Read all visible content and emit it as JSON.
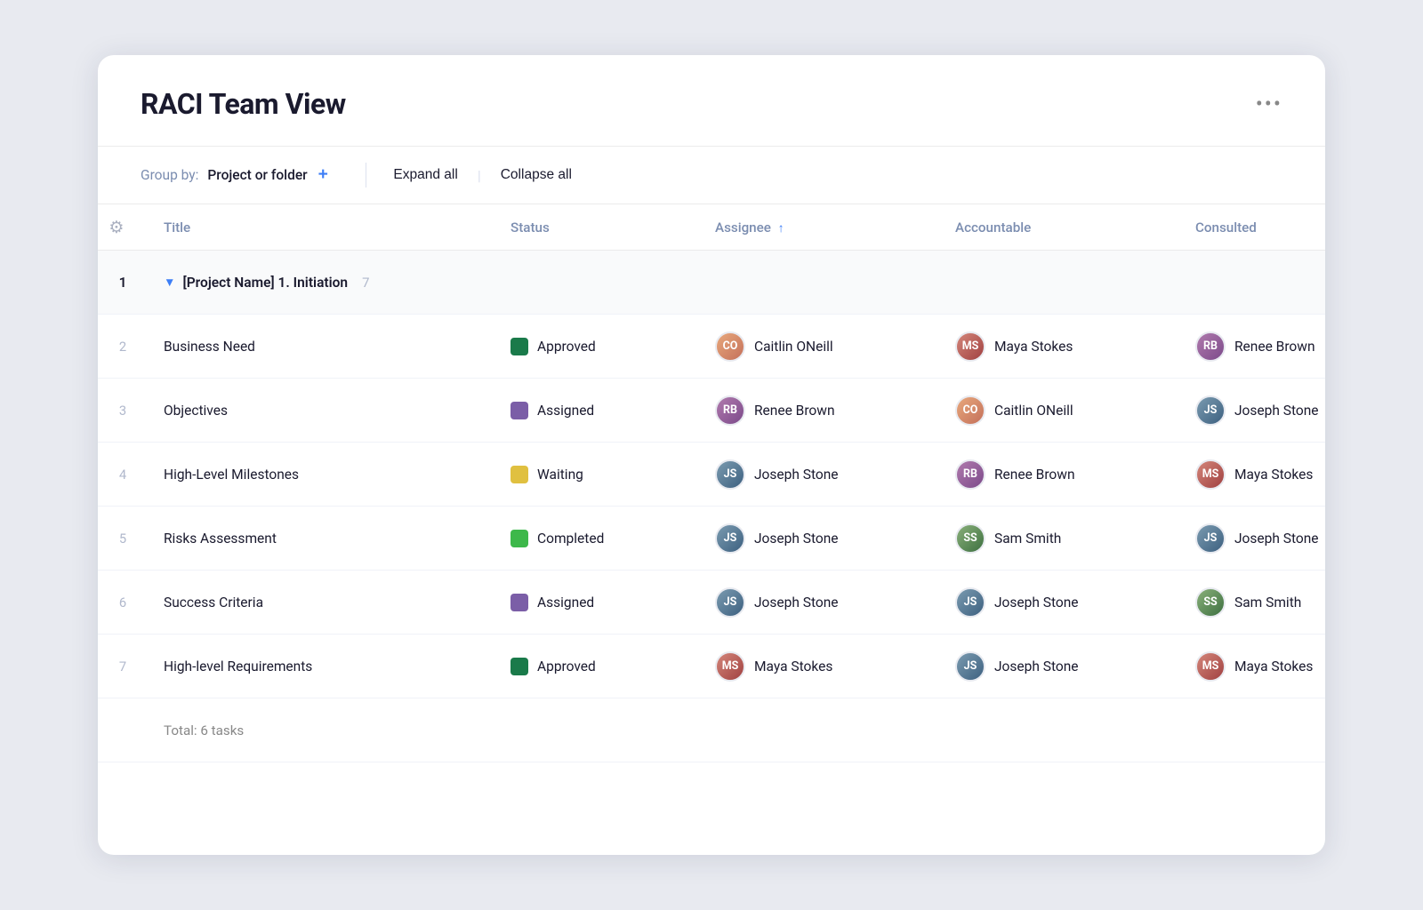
{
  "header": {
    "title": "RACI Team View",
    "more_icon": "•••"
  },
  "toolbar": {
    "group_by_label": "Group by:",
    "group_by_value": "Project or folder",
    "add_btn": "+",
    "expand_all": "Expand all",
    "collapse_all": "Collapse all"
  },
  "columns": [
    {
      "id": "gear",
      "label": "⚙"
    },
    {
      "id": "title",
      "label": "Title"
    },
    {
      "id": "status",
      "label": "Status"
    },
    {
      "id": "assignee",
      "label": "Assignee",
      "sort": "↑"
    },
    {
      "id": "accountable",
      "label": "Accountable"
    },
    {
      "id": "consulted",
      "label": "Consulted"
    }
  ],
  "project_group": {
    "name": "[Project Name] 1. Initiation",
    "count": "7"
  },
  "rows": [
    {
      "num": "2",
      "title": "Business Need",
      "status_label": "Approved",
      "status_color": "#1a7a4a",
      "assignee": "Caitlin ONeill",
      "assignee_av": "av-caitlin",
      "assignee_initials": "CO",
      "accountable": "Maya Stokes",
      "accountable_av": "av-maya",
      "accountable_initials": "MS",
      "consulted": "Renee Brown",
      "consulted_av": "av-renee",
      "consulted_initials": "RB"
    },
    {
      "num": "3",
      "title": "Objectives",
      "status_label": "Assigned",
      "status_color": "#7b5ea7",
      "assignee": "Renee Brown",
      "assignee_av": "av-renee",
      "assignee_initials": "RB",
      "accountable": "Caitlin ONeill",
      "accountable_av": "av-caitlin",
      "accountable_initials": "CO",
      "consulted": "Joseph Stone",
      "consulted_av": "av-joseph",
      "consulted_initials": "JS"
    },
    {
      "num": "4",
      "title": "High-Level Milestones",
      "status_label": "Waiting",
      "status_color": "#e0c040",
      "assignee": "Joseph Stone",
      "assignee_av": "av-joseph",
      "assignee_initials": "JS",
      "accountable": "Renee Brown",
      "accountable_av": "av-renee",
      "accountable_initials": "RB",
      "consulted": "Maya Stokes",
      "consulted_av": "av-maya",
      "consulted_initials": "MS"
    },
    {
      "num": "5",
      "title": "Risks Assessment",
      "status_label": "Completed",
      "status_color": "#3db84a",
      "assignee": "Joseph Stone",
      "assignee_av": "av-joseph",
      "assignee_initials": "JS",
      "accountable": "Sam Smith",
      "accountable_av": "av-sam",
      "accountable_initials": "SS",
      "consulted": "Joseph Stone",
      "consulted_av": "av-joseph",
      "consulted_initials": "JS"
    },
    {
      "num": "6",
      "title": "Success Criteria",
      "status_label": "Assigned",
      "status_color": "#7b5ea7",
      "assignee": "Joseph Stone",
      "assignee_av": "av-joseph",
      "assignee_initials": "JS",
      "accountable": "Joseph Stone",
      "accountable_av": "av-joseph",
      "accountable_initials": "JS",
      "consulted": "Sam Smith",
      "consulted_av": "av-sam",
      "consulted_initials": "SS"
    },
    {
      "num": "7",
      "title": "High-level Requirements",
      "status_label": "Approved",
      "status_color": "#1a7a4a",
      "assignee": "Maya Stokes",
      "assignee_av": "av-maya",
      "assignee_initials": "MS",
      "accountable": "Joseph Stone",
      "accountable_av": "av-joseph",
      "accountable_initials": "JS",
      "consulted": "Maya Stokes",
      "consulted_av": "av-maya",
      "consulted_initials": "MS"
    }
  ],
  "total": "Total: 6 tasks"
}
